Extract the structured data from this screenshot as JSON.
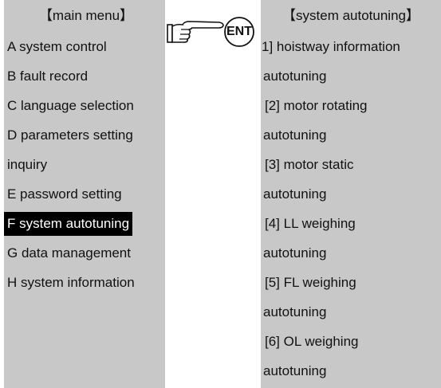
{
  "main_menu": {
    "title": "【main menu】",
    "items": [
      "A system control",
      "B fault record",
      "C language selection",
      "D parameters setting",
      "inquiry",
      "E password setting",
      "F system autotuning",
      "G data management",
      "H system information"
    ],
    "selected_index": 6
  },
  "enter_key": {
    "label": "ENT",
    "icon": "pointing-hand-icon"
  },
  "system_autotuning": {
    "title": "【system autotuning】",
    "lines": [
      "1] hoistway information",
      "autotuning",
      "[2] motor rotating",
      "autotuning",
      "[3] motor static",
      "autotuning",
      "[4] LL weighing",
      "autotuning",
      "[5] FL weighing",
      "autotuning",
      "[6] OL weighing",
      "autotuning"
    ]
  },
  "colors": {
    "panel_bg": "#c8c8c8",
    "highlight_bg": "#000000",
    "highlight_text": "#ffffff"
  }
}
